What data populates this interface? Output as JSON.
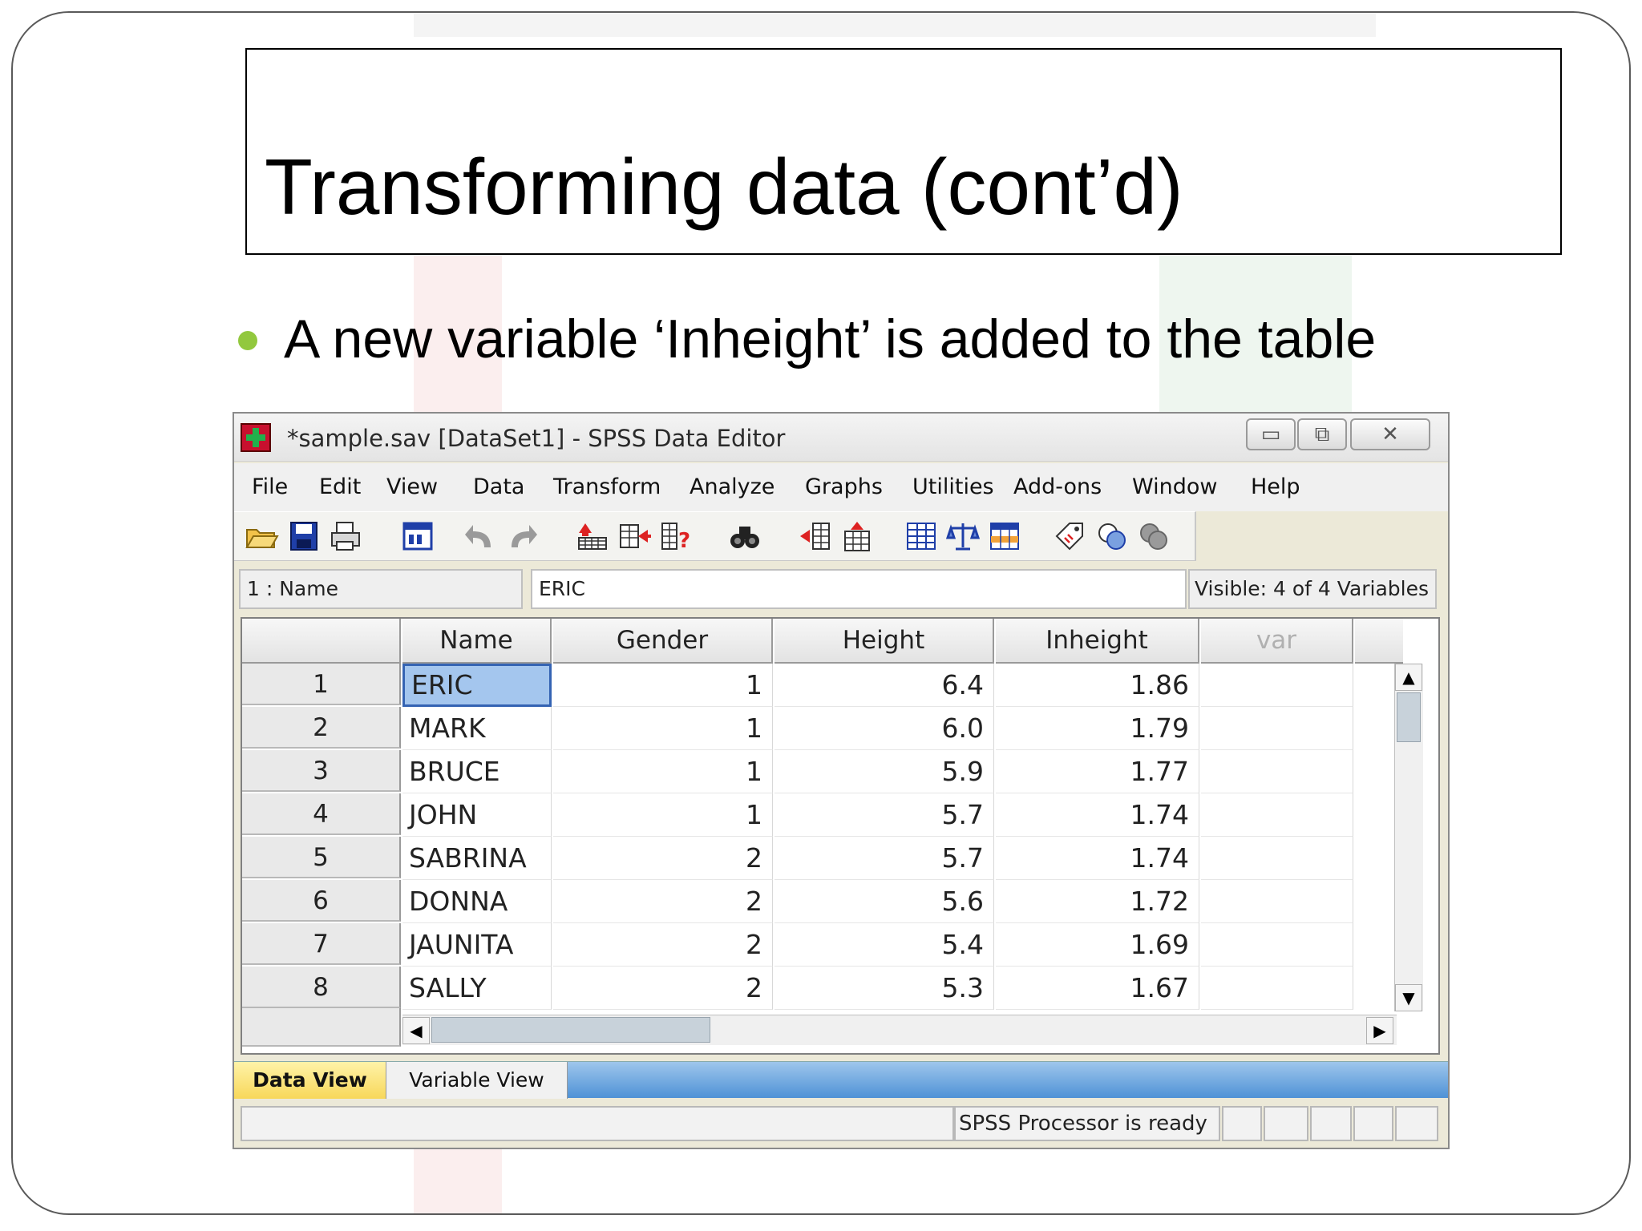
{
  "slide": {
    "title": "Transforming data (cont’d)",
    "bullet": "A new variable ‘Inheight’ is added to the table"
  },
  "window": {
    "title": "*sample.sav [DataSet1] - SPSS Data Editor",
    "controls": {
      "minimize": "▭",
      "maximize": "⧉",
      "close": "✕"
    },
    "menu": [
      "File",
      "Edit",
      "View",
      "Data",
      "Transform",
      "Analyze",
      "Graphs",
      "Utilities",
      "Add-ons",
      "Window",
      "Help"
    ],
    "toolbar_icons": [
      "open-icon",
      "save-icon",
      "print-icon",
      "dialog-recall-icon",
      "undo-icon",
      "redo-icon",
      "goto-case-icon",
      "goto-variable-icon",
      "variables-icon",
      "find-icon",
      "insert-cases-icon",
      "insert-variable-icon",
      "split-file-icon",
      "weight-cases-icon",
      "select-cases-icon",
      "value-labels-icon",
      "use-sets-icon",
      "show-all-variables-icon"
    ],
    "cell_ref": "1 : Name",
    "cell_value": "ERIC",
    "visible_label": "Visible: 4 of 4 Variables",
    "columns": [
      "Name",
      "Gender",
      "Height",
      "Inheight",
      "var"
    ],
    "rows": [
      {
        "n": "1",
        "name": "ERIC",
        "gender": "1",
        "height": "6.4",
        "inheight": "1.86"
      },
      {
        "n": "2",
        "name": "MARK",
        "gender": "1",
        "height": "6.0",
        "inheight": "1.79"
      },
      {
        "n": "3",
        "name": "BRUCE",
        "gender": "1",
        "height": "5.9",
        "inheight": "1.77"
      },
      {
        "n": "4",
        "name": "JOHN",
        "gender": "1",
        "height": "5.7",
        "inheight": "1.74"
      },
      {
        "n": "5",
        "name": "SABRINA",
        "gender": "2",
        "height": "5.7",
        "inheight": "1.74"
      },
      {
        "n": "6",
        "name": "DONNA",
        "gender": "2",
        "height": "5.6",
        "inheight": "1.72"
      },
      {
        "n": "7",
        "name": "JAUNITA",
        "gender": "2",
        "height": "5.4",
        "inheight": "1.69"
      },
      {
        "n": "8",
        "name": "SALLY",
        "gender": "2",
        "height": "5.3",
        "inheight": "1.67"
      }
    ],
    "tabs": [
      "Data View",
      "Variable View"
    ],
    "status": "SPSS  Processor is ready"
  },
  "colors": {
    "bullet": "#92c83e",
    "selection": "#a4c6ee",
    "tab_active": "#f7d75a",
    "tab_strip": "#4f92d6"
  }
}
